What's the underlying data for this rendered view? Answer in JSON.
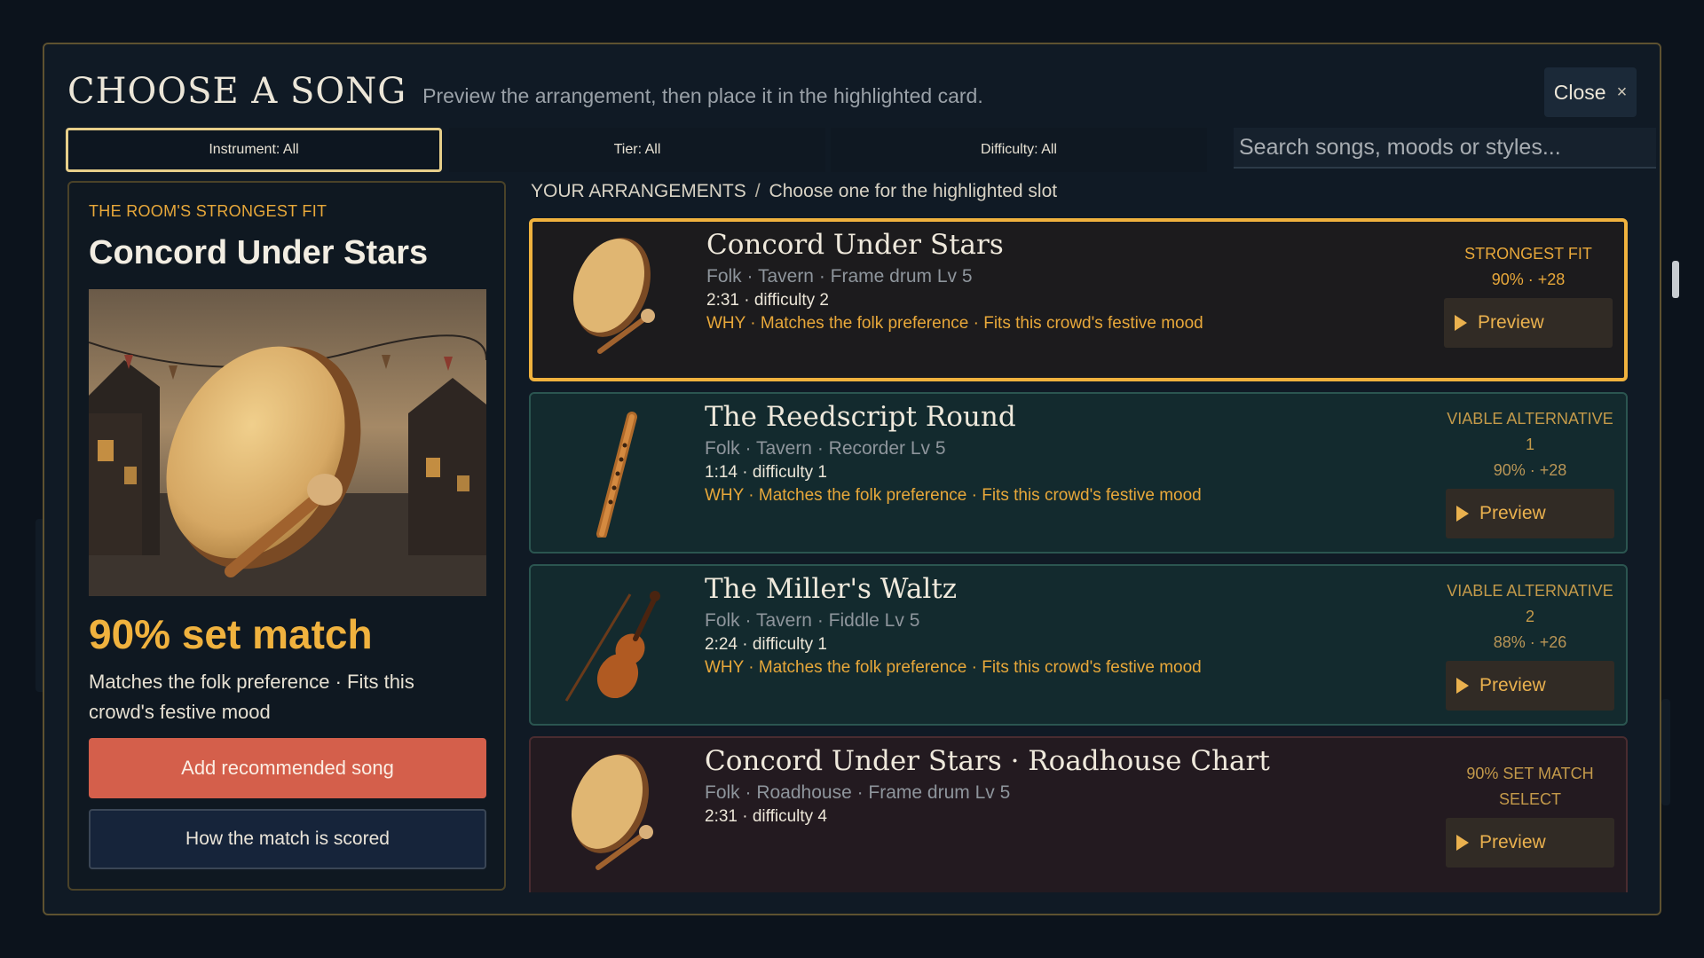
{
  "modal": {
    "title": "CHOOSE A SONG",
    "subtitle": "Preview the arrangement, then place it in the highlighted card.",
    "close_label": "Close",
    "close_glyph": "×"
  },
  "filters": {
    "instrument": "Instrument: All",
    "tier": "Tier: All",
    "difficulty": "Difficulty: All",
    "search_placeholder": "Search songs, moods or styles..."
  },
  "recommendation": {
    "eyebrow": "THE ROOM'S STRONGEST FIT",
    "title": "Concord Under Stars",
    "match": "90% set match",
    "why": "Matches the folk preference · Fits this crowd's festive mood",
    "add_label": "Add recommended song",
    "how_label": "How the match is scored"
  },
  "breadcrumb": {
    "section": "YOUR ARRANGEMENTS",
    "separator": "/",
    "hint": "Choose one for the highlighted slot"
  },
  "songs": [
    {
      "title": "Concord Under Stars",
      "meta": "Folk · Tavern · Frame drum Lv 5",
      "time": "2:31 · difficulty 2",
      "why": "WHY · Matches the folk preference · Fits this crowd's festive mood",
      "status": "STRONGEST FIT",
      "status_line2": "",
      "score": "90% · +28",
      "instrument_icon": "frame-drum-icon",
      "preview_label": "Preview"
    },
    {
      "title": "The Reedscript Round",
      "meta": "Folk · Tavern · Recorder Lv 5",
      "time": "1:14 · difficulty 1",
      "why": "WHY · Matches the folk preference · Fits this crowd's festive mood",
      "status": "VIABLE ALTERNATIVE",
      "status_line2": "1",
      "score": "90% · +28",
      "instrument_icon": "recorder-icon",
      "preview_label": "Preview"
    },
    {
      "title": "The Miller's Waltz",
      "meta": "Folk · Tavern · Fiddle Lv 5",
      "time": "2:24 · difficulty 1",
      "why": "WHY · Matches the folk preference · Fits this crowd's festive mood",
      "status": "VIABLE ALTERNATIVE",
      "status_line2": "2",
      "score": "88% · +26",
      "instrument_icon": "fiddle-icon",
      "preview_label": "Preview"
    },
    {
      "title": "Concord Under Stars · Roadhouse Chart",
      "meta": "Folk · Roadhouse · Frame drum Lv 5",
      "time": "2:31 · difficulty 4",
      "why": "",
      "status": "90% SET MATCH",
      "status_line2": "SELECT",
      "score": "",
      "instrument_icon": "frame-drum-icon",
      "preview_label": "Preview"
    }
  ],
  "colors": {
    "accent": "#f0b23e",
    "danger_button": "#d45f4b",
    "modal_bg": "#101a25",
    "card_teal": "#132a2e",
    "card_rose": "#231a20"
  }
}
